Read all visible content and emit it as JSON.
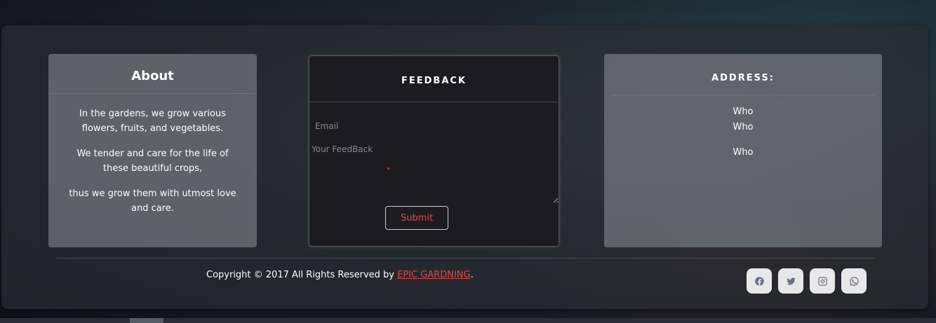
{
  "about": {
    "title": "About",
    "paragraphs": [
      "In the gardens, we grow various flowers, fruits, and vegetables.",
      "We tender and care for the life of these beautiful crops,",
      "thus we grow them with utmost love and care."
    ]
  },
  "feedback": {
    "title": "FEEDBACK",
    "email_placeholder": "Email",
    "email_value": "",
    "feedback_placeholder": "Your FeedBack",
    "feedback_value": "",
    "submit_label": "Submit"
  },
  "address": {
    "title": "ADDRESS:",
    "lines": [
      "Who",
      "Who",
      "Who"
    ]
  },
  "footer": {
    "copyright_prefix": "Copyright © 2017 All Rights Reserved by ",
    "brand_link": "EPIC GARDNING",
    "copyright_suffix": "."
  },
  "social": {
    "icons": [
      "facebook-icon",
      "twitter-icon",
      "instagram-icon",
      "whatsapp-icon"
    ]
  },
  "colors": {
    "accent": "#e04848",
    "card_bg": "#8c9298",
    "feedback_bg": "#1c1c1e"
  }
}
